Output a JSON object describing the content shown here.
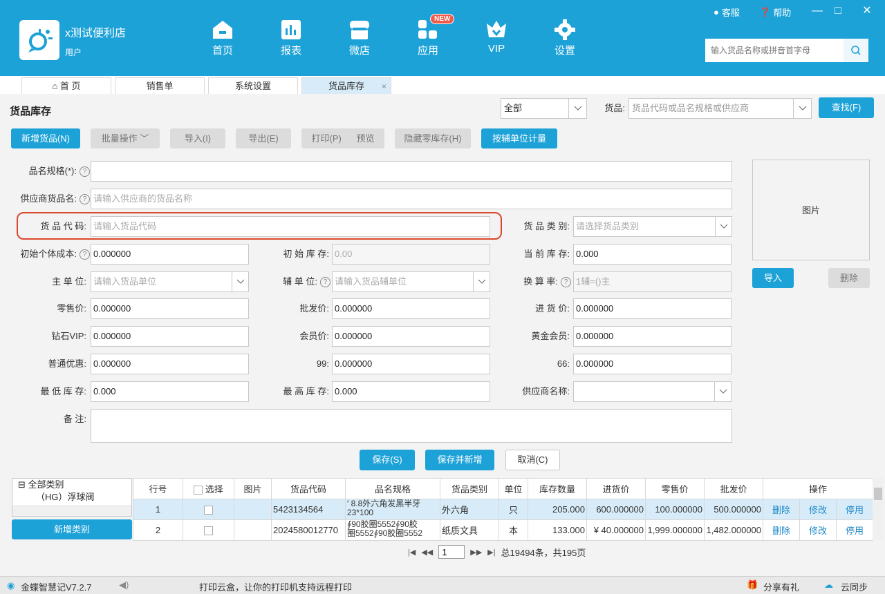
{
  "header": {
    "store_name": "x测试便利店",
    "user_label": "用户",
    "nav": [
      {
        "label": "首页",
        "icon": "home-icon"
      },
      {
        "label": "报表",
        "icon": "report-icon"
      },
      {
        "label": "微店",
        "icon": "shop-icon"
      },
      {
        "label": "应用",
        "icon": "apps-icon",
        "badge": "NEW"
      },
      {
        "label": "VIP",
        "icon": "vip-icon"
      },
      {
        "label": "设置",
        "icon": "gear-icon"
      }
    ],
    "service_label": "客服",
    "help_label": "帮助",
    "search_placeholder": "输入货品名称或拼音首字母",
    "accent": "#1da2d8"
  },
  "tabs": [
    {
      "label": "首 页"
    },
    {
      "label": "销售单"
    },
    {
      "label": "系统设置"
    },
    {
      "label": "货品库存",
      "active": true,
      "close": "×"
    }
  ],
  "toolbar": {
    "page_title": "货品库存",
    "filter_value": "全部",
    "goods_label": "货品:",
    "goods_placeholder": "货品代码或品名规格或供应商",
    "search_btn": "查找(F)",
    "buttons": {
      "add_goods": "新增货品(N)",
      "batch": "批量操作",
      "import": "导入(I)",
      "export": "导出(E)",
      "print": "打印(P)",
      "preview": "预览",
      "hide_zero": "隐藏零库存(H)",
      "aux_unit": "按辅单位计量"
    }
  },
  "form": {
    "name_spec": {
      "label": "品名规格(*):",
      "value": ""
    },
    "supplier_name": {
      "label": "供应商货品名:",
      "placeholder": "请输入供应商的货品名称"
    },
    "code": {
      "label": "货 品 代 码:",
      "placeholder": "请输入货品代码"
    },
    "category": {
      "label": "货 品 类 别:",
      "placeholder": "请选择货品类别"
    },
    "init_cost": {
      "label": "初始个体成本:",
      "value": "0.000000"
    },
    "init_stock": {
      "label": "初 始 库 存:",
      "placeholder": "0.00"
    },
    "cur_stock": {
      "label": "当 前 库 存:",
      "value": "0.000"
    },
    "main_unit": {
      "label": "主    单    位:",
      "placeholder": "请输入货品单位"
    },
    "aux_unit": {
      "label": "辅 单 位:",
      "placeholder": "请输入货品辅单位"
    },
    "conv_rate": {
      "label": "换 算 率:",
      "placeholder": "1辅=()主"
    },
    "retail": {
      "label": "零售价:",
      "value": "0.000000"
    },
    "wholesale": {
      "label": "批发价:",
      "value": "0.000000"
    },
    "purchase": {
      "label": "进    货    价:",
      "value": "0.000000"
    },
    "diamond_vip": {
      "label": "钻石VIP:",
      "value": "0.000000"
    },
    "member": {
      "label": "会员价:",
      "value": "0.000000"
    },
    "gold": {
      "label": "黄金会员:",
      "value": "0.000000"
    },
    "normal": {
      "label": "普通优惠:",
      "value": "0.000000"
    },
    "p99": {
      "label": "99:",
      "value": "0.000000"
    },
    "p66": {
      "label": "66:",
      "value": "0.000000"
    },
    "min_stock": {
      "label": "最 低 库 存:",
      "value": "0.000"
    },
    "max_stock": {
      "label": "最 高 库 存:",
      "value": "0.000"
    },
    "supplier": {
      "label": "供应商名称:",
      "value": ""
    },
    "remark": {
      "label": "备      注:",
      "value": ""
    },
    "image_label": "图片",
    "import_btn": "导入",
    "delete_btn": "删除",
    "save_btn": "保存(S)",
    "save_new_btn": "保存并新增",
    "cancel_btn": "取消(C)"
  },
  "tree": {
    "root": "全部类别",
    "child": "（HG）浮球阀",
    "add_btn": "新增类别"
  },
  "grid": {
    "headers": [
      "行号",
      "选择",
      "图片",
      "货品代码",
      "品名规格",
      "货品类别",
      "单位",
      "库存数量",
      "进货价",
      "零售价",
      "批发价",
      "操作"
    ],
    "rows": [
      {
        "no": "1",
        "code": "5423134564",
        "name": "′ 8.8外六角发黑半牙",
        "name2": "23*100",
        "cat": "外六角",
        "unit": "只",
        "qty": "205.000",
        "buy": "600.000000",
        "retail": "100.000000",
        "whole": "500.000000"
      },
      {
        "no": "2",
        "code": "2024580012770",
        "name": "∮90胶圈5552∮90胶",
        "name2": "圈5552∮90胶圈5552",
        "cat": "纸质文具",
        "unit": "本",
        "qty": "133.000",
        "buy": "¥ 40.000000",
        "retail": "1,999.000000",
        "whole": "1,482.000000"
      }
    ],
    "ops": [
      "删除",
      "修改",
      "停用"
    ]
  },
  "pager": {
    "page": "1",
    "summary": "总19494条，共195页"
  },
  "status": {
    "version": "金蝶智慧记V7.2.7",
    "message": "打印云盒，让你的打印机支持远程打印",
    "share": "分享有礼",
    "sync": "云同步"
  }
}
